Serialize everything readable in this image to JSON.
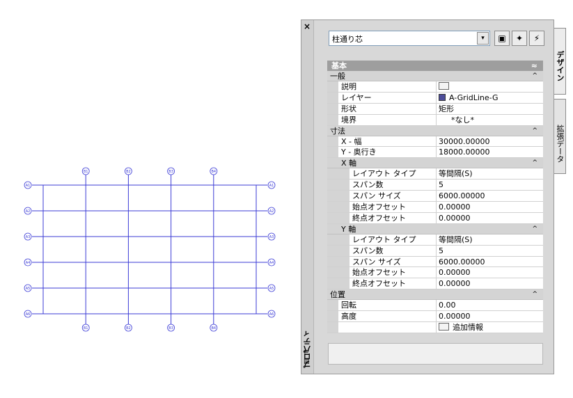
{
  "drawing": {
    "top_bubbles": [
      "B1",
      "B2",
      "B3",
      "B4"
    ],
    "bottom_bubbles": [
      "B1",
      "B2",
      "B3",
      "B4"
    ],
    "left_bubbles": [
      "A1",
      "A2",
      "A3",
      "A4",
      "A5",
      "A6"
    ],
    "right_bubbles": [
      "A1",
      "A2",
      "A3",
      "A4",
      "A5",
      "A6"
    ],
    "line_color": "#3b3bd6"
  },
  "palette": {
    "close_glyph": "×",
    "title": "プロパティ",
    "style_selector": {
      "value": "柱通り芯",
      "dropdown_glyph": "▾"
    },
    "tools": [
      {
        "name": "select-objects-icon",
        "glyph": "▣"
      },
      {
        "name": "pick-add-icon",
        "glyph": "✦"
      },
      {
        "name": "quick-select-icon",
        "glyph": "⚡"
      }
    ],
    "section_header": {
      "label": "基本",
      "chevron": "≈"
    },
    "general": {
      "label": "一般",
      "chevron": "^",
      "rows": [
        {
          "name": "説明",
          "value": "",
          "icon": "note"
        },
        {
          "name": "レイヤー",
          "value": "A-GridLine-G",
          "icon": "swatch"
        },
        {
          "name": "形状",
          "value": "矩形"
        },
        {
          "name": "境界",
          "value": "*なし*"
        }
      ]
    },
    "dimensions": {
      "label": "寸法",
      "chevron": "^",
      "rows": [
        {
          "name": "X - 幅",
          "value": "30000.00000"
        },
        {
          "name": "Y - 奥行き",
          "value": "18000.00000"
        }
      ],
      "x_axis": {
        "label": "X 軸",
        "chevron": "^",
        "rows": [
          {
            "name": "レイアウト タイプ",
            "value": "等間隔(S)"
          },
          {
            "name": "スパン数",
            "value": "5"
          },
          {
            "name": "スパン サイズ",
            "value": "6000.00000"
          },
          {
            "name": "始点オフセット",
            "value": "0.00000"
          },
          {
            "name": "終点オフセット",
            "value": "0.00000"
          }
        ]
      },
      "y_axis": {
        "label": "Y 軸",
        "chevron": "^",
        "rows": [
          {
            "name": "レイアウト タイプ",
            "value": "等間隔(S)"
          },
          {
            "name": "スパン数",
            "value": "5"
          },
          {
            "name": "スパン サイズ",
            "value": "6000.00000"
          },
          {
            "name": "始点オフセット",
            "value": "0.00000"
          },
          {
            "name": "終点オフセット",
            "value": "0.00000"
          }
        ]
      }
    },
    "location": {
      "label": "位置",
      "chevron": "^",
      "rows": [
        {
          "name": "回転",
          "value": "0.00"
        },
        {
          "name": "高度",
          "value": "0.00000"
        },
        {
          "name": "",
          "value": "追加情報",
          "icon": "note"
        }
      ]
    },
    "tabs": {
      "design": "デザイン",
      "extended": "拡張データ"
    }
  }
}
